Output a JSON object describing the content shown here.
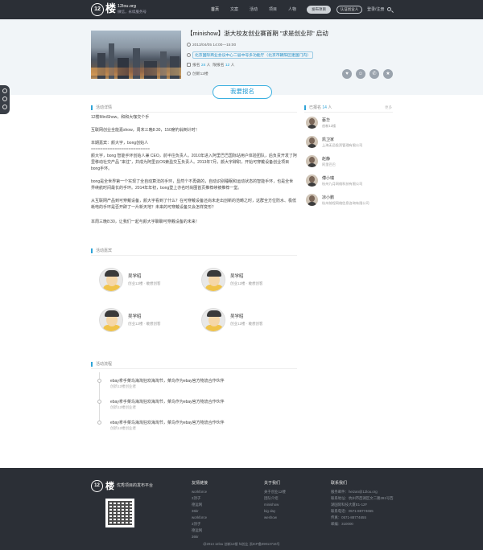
{
  "header": {
    "logo_mark": "12",
    "logo_char": "楼",
    "site": "12lou.org",
    "tagline": "微信，永续服务号",
    "nav": [
      "首页",
      "文案",
      "活动",
      "项目",
      "人物"
    ],
    "publish_btn": "发布项目",
    "verify_btn": "认证创业人",
    "login": "登录/注册"
  },
  "event": {
    "title": "【minishow】浙大校友创业赛首期 \"求是创业邦\" 启动",
    "time": "2013/04/05  14:00—15:00",
    "address": "北京国际商业会议中心二层中号多功能厅（北京市朝阳区建国门内）",
    "registered_label": "报名",
    "registered_count": "24",
    "registered_unit": "人",
    "limit_label": "限报名",
    "limit_count": "12",
    "limit_unit": "人",
    "organizer": "创新12楼",
    "signup_btn": "我要报名"
  },
  "share": [
    "♥",
    "☺",
    "✆",
    "★"
  ],
  "details": {
    "heading": "活动详情",
    "intro1": "12楼MiniShow，和和大咖交个手",
    "intro2": "互联网创业全能嘉show，周末三晚8:30，150席钓翁倒计时！",
    "guest_label": "本期嘉宾：颜大宇，bong创始人",
    "divider": "=========================",
    "bio": "颜大宇，bong 智能手环创始人兼 CEO，前半往负责人。2010年进入阿里巴巴国际站用户体验团队，后负责开发了阿里移动社交产品 \"来往\"，并成为阿里云OS索盈交互负责人。2013年7月，颜大宇辞职，开始可穿戴设备创业项目bong手环。",
    "p2": "bong是全世界第一个实现了全自动算法的手环，显然个不再做的，自动识别睡眠和运动状态的智能手环，也是全世界续航时间最长的手环。2014年年初，bong登上亦名时尚圈首页推荐续被推荐一堂。",
    "p3": "从互联网产品到可穿戴设备，颜大宇看到了什么？在可穿戴设备还尚未走出创新的范畴之时，这群全方位防水、极低耗电的手环是否开辟了一片新天地？未来的可穿戴设备又会怎样变形？",
    "p4": "本周三晚8:30，让我们一起与颜大宇聊聊可穿戴设备的未来！"
  },
  "guests": {
    "heading": "活动嘉宾",
    "items": [
      {
        "name": "吴学昭",
        "sub": "创业12楼 · 敢想创客"
      },
      {
        "name": "吴学昭",
        "sub": "创业12楼 · 敢想创客"
      },
      {
        "name": "吴学昭",
        "sub": "创业12楼 · 敢想创客"
      },
      {
        "name": "吴学昭",
        "sub": "创业12楼 · 敢想创客"
      }
    ]
  },
  "flow": {
    "heading": "活动流程",
    "items": [
      {
        "text": "ebay拿手菜鸟海淘狂欢海淘节，菜鸟作为ebay官方物流合作伙伴",
        "sub": "创新12楼创业者"
      },
      {
        "text": "ebay拿手菜鸟海淘狂欢海淘节，菜鸟作为ebay官方物流合作伙伴",
        "sub": "创新12楼创业者"
      },
      {
        "text": "ebay拿手菜鸟海淘狂欢海淘节，菜鸟作为ebay官方物流合作伙伴",
        "sub": "创新12楼创业者"
      }
    ]
  },
  "attendees": {
    "heading_label": "已报名",
    "count": "14",
    "unit": "人",
    "more": "更多",
    "items": [
      {
        "name": "蔡华",
        "sub": "创新12楼"
      },
      {
        "name": "凯卫家",
        "sub": "上海无忌投资管理有限公司"
      },
      {
        "name": "赵静",
        "sub": "阿里巴巴"
      },
      {
        "name": "傅小瑞",
        "sub": "杭州九月网络科技有限公司"
      },
      {
        "name": "凉小鹏",
        "sub": "杭州前程网络信息咨询有限公司"
      }
    ]
  },
  "footer": {
    "logo_mark": "12",
    "logo_char": "楼",
    "slogan": "优秀项目的发布平台",
    "col1_title": "友情链接",
    "col1_links": [
      "workforce",
      "3顶子",
      "德运网",
      "36kr",
      "workforce",
      "3顶子",
      "德运网",
      "36kr"
    ],
    "col2_title": "关于我们",
    "col2_links": [
      "关于创业12楼",
      "团队介绍",
      "minishow",
      "big day",
      "weshow"
    ],
    "col3_title": "联系我们",
    "col3_links": [
      "服务邮件：heizan@12lou.org",
      "联系地址：杭州市西湖区文二路391号西",
      "湖国际科技大厦E1-12F",
      "联系电话：0571-88774655",
      "传真：0571-88774655",
      "邮编：310000"
    ],
    "copyright": "@2014 12lou 创新12楼 hi创业 浙ICP备09013716号"
  }
}
